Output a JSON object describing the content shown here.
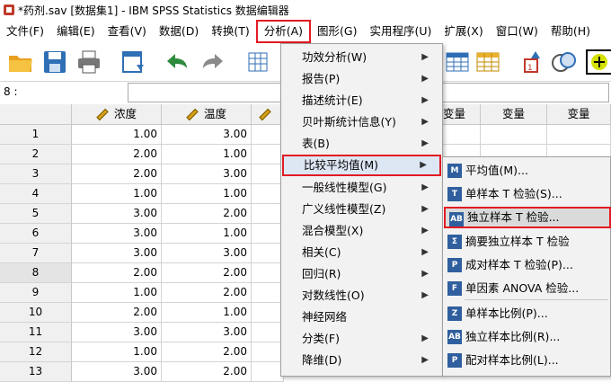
{
  "window": {
    "title": "*药剂.sav [数据集1] - IBM SPSS Statistics 数据编辑器"
  },
  "menubar": [
    {
      "label": "文件(F)"
    },
    {
      "label": "编辑(E)"
    },
    {
      "label": "查看(V)"
    },
    {
      "label": "数据(D)"
    },
    {
      "label": "转换(T)"
    },
    {
      "label": "分析(A)"
    },
    {
      "label": "图形(G)"
    },
    {
      "label": "实用程序(U)"
    },
    {
      "label": "扩展(X)"
    },
    {
      "label": "窗口(W)"
    },
    {
      "label": "帮助(H)"
    }
  ],
  "cellbar": {
    "ref": "8 :"
  },
  "grid": {
    "columns": [
      "浓度",
      "温度",
      "变量",
      "变量",
      "变量"
    ],
    "rows": [
      {
        "n": "1",
        "c1": "1.00",
        "c2": "3.00"
      },
      {
        "n": "2",
        "c1": "2.00",
        "c2": "1.00"
      },
      {
        "n": "3",
        "c1": "2.00",
        "c2": "3.00"
      },
      {
        "n": "4",
        "c1": "1.00",
        "c2": "1.00"
      },
      {
        "n": "5",
        "c1": "3.00",
        "c2": "2.00"
      },
      {
        "n": "6",
        "c1": "3.00",
        "c2": "1.00"
      },
      {
        "n": "7",
        "c1": "3.00",
        "c2": "3.00"
      },
      {
        "n": "8",
        "c1": "2.00",
        "c2": "2.00"
      },
      {
        "n": "9",
        "c1": "1.00",
        "c2": "2.00"
      },
      {
        "n": "10",
        "c1": "2.00",
        "c2": "1.00"
      },
      {
        "n": "11",
        "c1": "3.00",
        "c2": "3.00"
      },
      {
        "n": "12",
        "c1": "1.00",
        "c2": "2.00"
      },
      {
        "n": "13",
        "c1": "3.00",
        "c2": "2.00"
      }
    ]
  },
  "analyze_menu": [
    {
      "label": "功效分析(W)"
    },
    {
      "label": "报告(P)"
    },
    {
      "label": "描述统计(E)"
    },
    {
      "label": "贝叶斯统计信息(Y)"
    },
    {
      "label": "表(B)"
    },
    {
      "label": "比较平均值(M)"
    },
    {
      "label": "一般线性模型(G)"
    },
    {
      "label": "广义线性模型(Z)"
    },
    {
      "label": "混合模型(X)"
    },
    {
      "label": "相关(C)"
    },
    {
      "label": "回归(R)"
    },
    {
      "label": "对数线性(O)"
    },
    {
      "label": "神经网络"
    },
    {
      "label": "分类(F)"
    },
    {
      "label": "降维(D)"
    }
  ],
  "compare_means_menu": [
    {
      "label": "平均值(M)...",
      "icon": "M"
    },
    {
      "label": "单样本 T 检验(S)...",
      "icon": "T"
    },
    {
      "label": "独立样本 T 检验...",
      "icon": "AB"
    },
    {
      "label": "摘要独立样本 T 检验",
      "icon": "Σ"
    },
    {
      "label": "成对样本 T 检验(P)...",
      "icon": "P"
    },
    {
      "label": "单因素 ANOVA 检验...",
      "icon": "F"
    },
    {
      "label": "单样本比例(P)...",
      "icon": "Z"
    },
    {
      "label": "独立样本比例(R)...",
      "icon": "AB"
    },
    {
      "label": "配对样本比例(L)...",
      "icon": "P"
    }
  ]
}
